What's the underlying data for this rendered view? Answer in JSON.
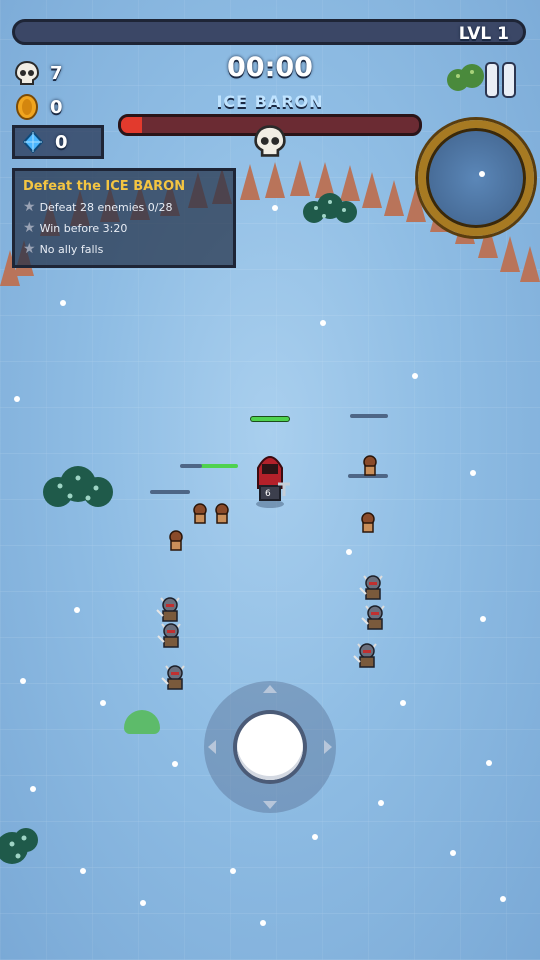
{
  "hud": {
    "level_label": "LVL 1",
    "kills": "7",
    "coins": "0",
    "gems": "0",
    "timer": "00:00",
    "boss_name": "ICE BARON",
    "boss_health_fraction": 0.07,
    "xp_fraction": 0.0
  },
  "quest": {
    "title": "Defeat the ICE BARON",
    "items": [
      {
        "text": "Defeat 28 enemies  0/28"
      },
      {
        "text": "Win before 3:20"
      },
      {
        "text": "No ally falls"
      }
    ]
  },
  "icons": {
    "skull": "skull-icon",
    "coin": "coin-icon",
    "gem": "gem-icon",
    "pause": "pause-icon"
  },
  "colors": {
    "boss_health": "#e23a2d",
    "ally_health": "#4fd24f",
    "quest_title": "#f4c542",
    "ice": "#8fbde4"
  }
}
